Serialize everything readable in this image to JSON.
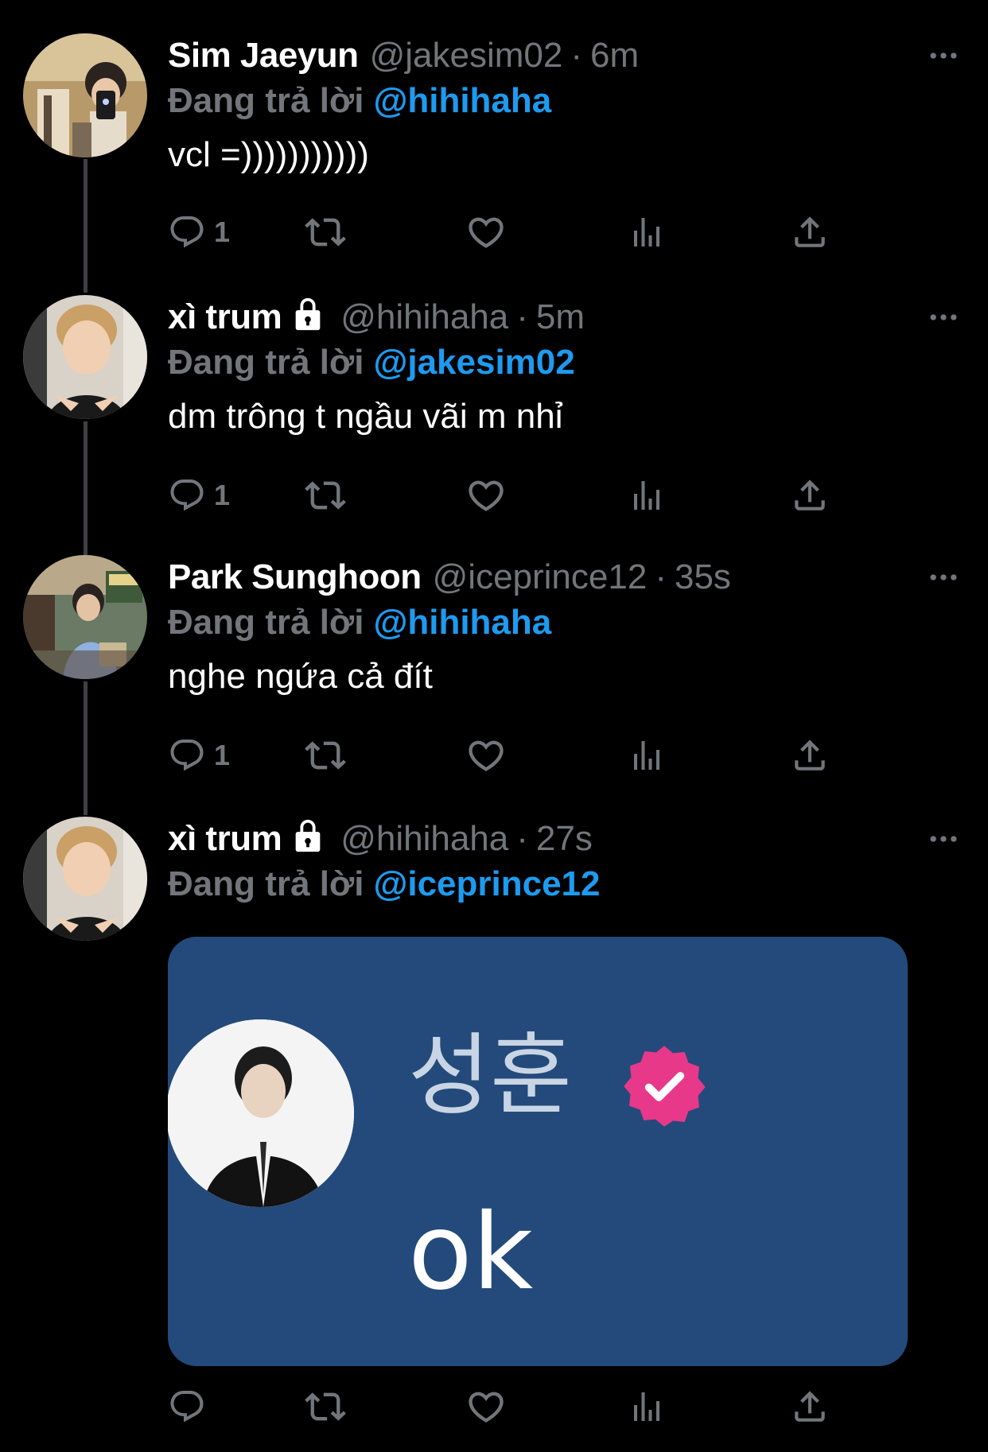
{
  "colors": {
    "background": "#000000",
    "text": "#e7e9ea",
    "muted": "#71767b",
    "accent": "#1d9bf0",
    "thread_line": "#3e4144",
    "media_bg": "#234a7b",
    "badge": "#e8388a"
  },
  "reply_prefix": "Đang trả lời",
  "tweets": [
    {
      "name": "Sim Jaeyun",
      "locked": false,
      "handle": "@jakesim02",
      "separator": "·",
      "time": "6m",
      "reply_to": "@hihihaha",
      "text": "vcl =)))))))))))",
      "reply_count": "1"
    },
    {
      "name": "xì trum",
      "locked": true,
      "handle": "@hihihaha",
      "separator": "·",
      "time": "5m",
      "reply_to": "@jakesim02",
      "text": "dm trông t ngầu vãi m nhỉ",
      "reply_count": "1"
    },
    {
      "name": "Park Sunghoon",
      "locked": false,
      "handle": "@iceprince12",
      "separator": "·",
      "time": "35s",
      "reply_to": "@hihihaha",
      "text": "nghe ngứa cả đít",
      "reply_count": "1"
    },
    {
      "name": "xì trum",
      "locked": true,
      "handle": "@hihihaha",
      "separator": "·",
      "time": "27s",
      "reply_to": "@iceprince12",
      "text": "",
      "reply_count": "",
      "media": {
        "name": "성훈",
        "message": "ok",
        "verified_icon": "pink-verified-badge-icon"
      }
    }
  ],
  "icons": {
    "reply": "speech-bubble-icon",
    "retweet": "retweet-arrows-icon",
    "like": "heart-icon",
    "views": "bar-chart-icon",
    "share": "share-upload-icon",
    "more": "more-dots-icon",
    "lock": "lock-icon"
  }
}
